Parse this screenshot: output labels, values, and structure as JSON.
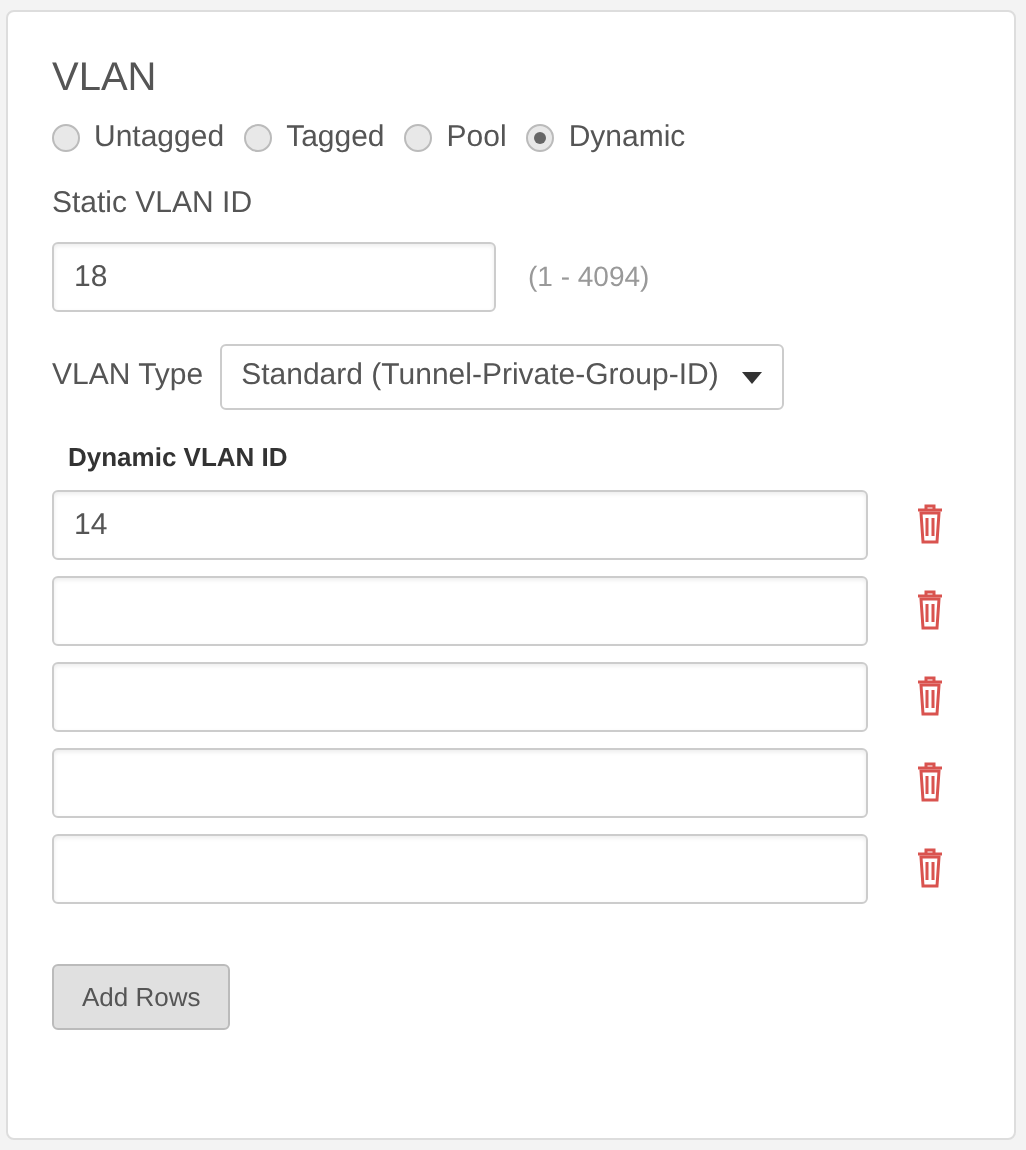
{
  "section": {
    "title": "VLAN"
  },
  "vlan_modes": [
    {
      "label": "Untagged",
      "selected": false
    },
    {
      "label": "Tagged",
      "selected": false
    },
    {
      "label": "Pool",
      "selected": false
    },
    {
      "label": "Dynamic",
      "selected": true
    }
  ],
  "static_vlan_id": {
    "label": "Static VLAN ID",
    "value": "18",
    "hint": "(1 - 4094)"
  },
  "vlan_type": {
    "label": "VLAN Type",
    "value": "Standard (Tunnel-Private-Group-ID)"
  },
  "dynamic_vlan_ids": {
    "heading": "Dynamic VLAN ID",
    "rows": [
      {
        "value": "14"
      },
      {
        "value": ""
      },
      {
        "value": ""
      },
      {
        "value": ""
      },
      {
        "value": ""
      }
    ]
  },
  "buttons": [
    "Add Rows"
  ]
}
